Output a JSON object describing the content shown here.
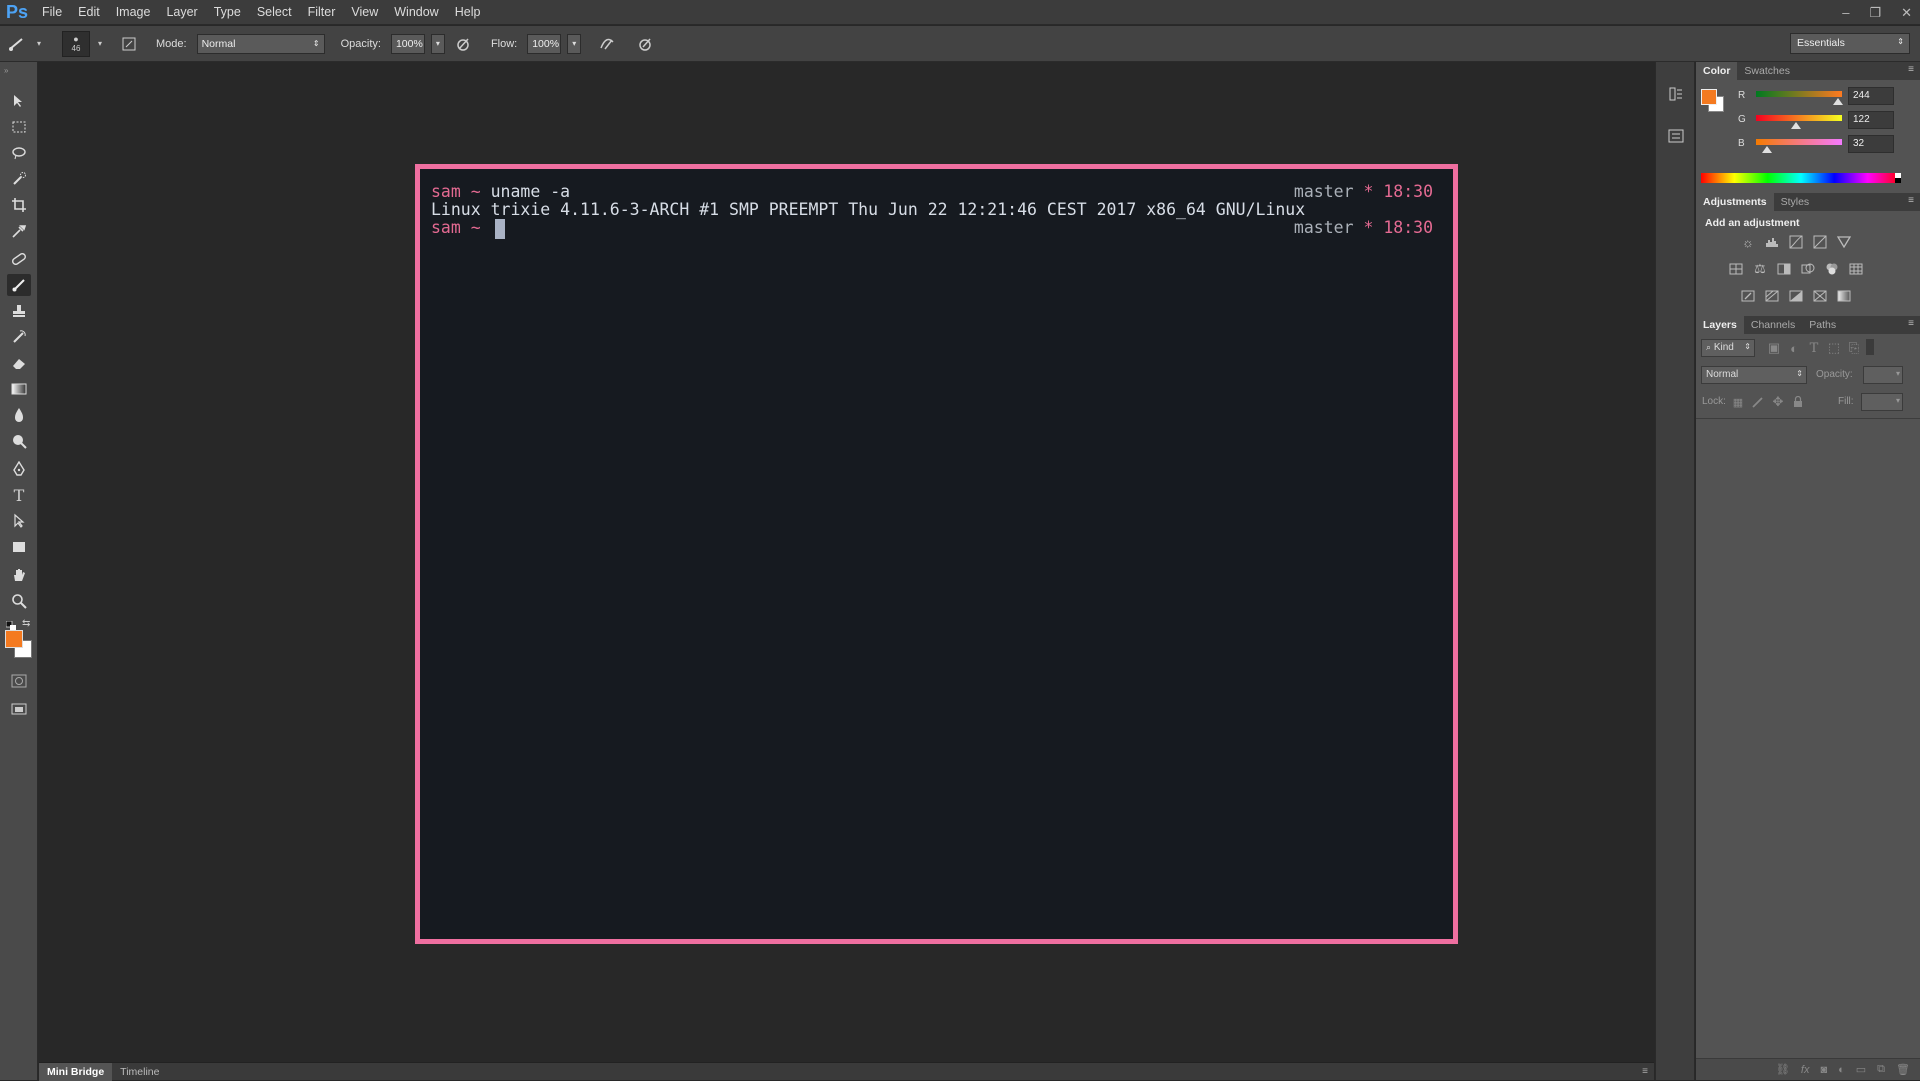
{
  "app": {
    "logo": "Ps"
  },
  "menu": [
    "File",
    "Edit",
    "Image",
    "Layer",
    "Type",
    "Select",
    "Filter",
    "View",
    "Window",
    "Help"
  ],
  "window_controls": {
    "minimize": "–",
    "restore": "❐",
    "close": "✕"
  },
  "options_bar": {
    "brush_size": "46",
    "mode_label": "Mode:",
    "mode_value": "Normal",
    "opacity_label": "Opacity:",
    "opacity_value": "100%",
    "flow_label": "Flow:",
    "flow_value": "100%",
    "workspace": "Essentials"
  },
  "terminal": {
    "line1_user": "sam ~ ",
    "line1_cmd": "uname -a",
    "line1_branch": "master ",
    "line1_star": "* ",
    "line1_time": "18:30",
    "line2": "Linux trixie 4.11.6-3-ARCH #1 SMP PREEMPT Thu Jun 22 12:21:46 CEST 2017 x86_64 GNU/Linux",
    "line3_user": "sam ~ ",
    "line3_branch": "master ",
    "line3_star": "* ",
    "line3_time": "18:30",
    "border_color": "#ef6fa0",
    "background": "#161a20"
  },
  "bottom_tabs": [
    "Mini Bridge",
    "Timeline"
  ],
  "color_panel": {
    "tabs": [
      "Color",
      "Swatches"
    ],
    "r_label": "R",
    "r_value": "244",
    "g_label": "G",
    "g_value": "122",
    "b_label": "B",
    "b_value": "32",
    "foreground": "#f47a20"
  },
  "adjustments_panel": {
    "tabs": [
      "Adjustments",
      "Styles"
    ],
    "heading": "Add an adjustment"
  },
  "layers_panel": {
    "tabs": [
      "Layers",
      "Channels",
      "Paths"
    ],
    "kind_label": "Kind",
    "blend_mode": "Normal",
    "opacity_label": "Opacity:",
    "lock_label": "Lock:",
    "fill_label": "Fill:"
  }
}
